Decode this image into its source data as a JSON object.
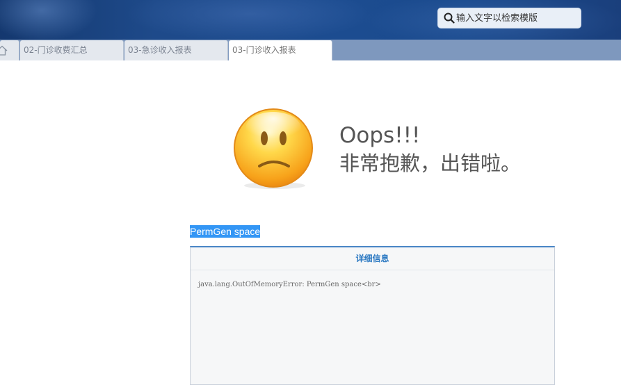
{
  "header": {
    "search": {
      "placeholder": "输入文字以检索模版",
      "icon": "search-icon"
    }
  },
  "tabs": [
    {
      "label": "",
      "icon": "home-icon",
      "active": false
    },
    {
      "label": "02-门诊收费汇总",
      "active": false
    },
    {
      "label": "03-急诊收入报表",
      "active": false
    },
    {
      "label": "03-门诊收入报表",
      "active": true
    }
  ],
  "error": {
    "face_icon": "sad-face-icon",
    "title": "Oops!!!",
    "subtitle": "非常抱歉，出错啦。",
    "message": "PermGen space",
    "details_title": "详细信息",
    "details_text": "java.lang.OutOfMemoryError: PermGen space<br>"
  },
  "colors": {
    "banner": "#1c4c90",
    "tabbar": "#7e98be",
    "accent": "#2c79c2",
    "selection": "#3396f5"
  }
}
